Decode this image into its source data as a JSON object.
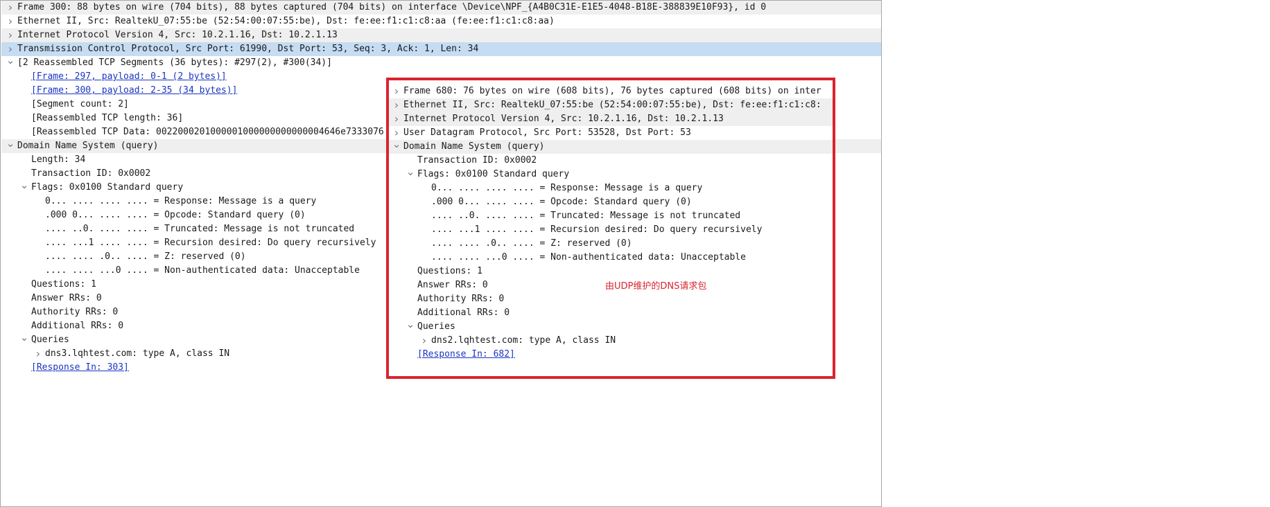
{
  "main_tree": [
    {
      "text": "Frame 300: 88 bytes on wire (704 bits), 88 bytes captured (704 bits) on interface \\Device\\NPF_{A4B0C31E-E1E5-4048-B18E-388839E10F93}, id 0",
      "indent": 0,
      "arrow": "right",
      "style": "shade"
    },
    {
      "text": "Ethernet II, Src: RealtekU_07:55:be (52:54:00:07:55:be), Dst: fe:ee:f1:c1:c8:aa (fe:ee:f1:c1:c8:aa)",
      "indent": 0,
      "arrow": "right",
      "style": "plain"
    },
    {
      "text": "Internet Protocol Version 4, Src: 10.2.1.16, Dst: 10.2.1.13",
      "indent": 0,
      "arrow": "right",
      "style": "shade"
    },
    {
      "text": "Transmission Control Protocol, Src Port: 61990, Dst Port: 53, Seq: 3, Ack: 1, Len: 34",
      "indent": 0,
      "arrow": "right",
      "style": "sel"
    },
    {
      "text": "[2 Reassembled TCP Segments (36 bytes): #297(2), #300(34)]",
      "indent": 0,
      "arrow": "down",
      "style": "plain"
    },
    {
      "text": "[Frame: 297, payload: 0-1 (2 bytes)]",
      "indent": 1,
      "arrow": "",
      "style": "plain",
      "link": true
    },
    {
      "text": "[Frame: 300, payload: 2-35 (34 bytes)]",
      "indent": 1,
      "arrow": "",
      "style": "plain",
      "link": true
    },
    {
      "text": "[Segment count: 2]",
      "indent": 1,
      "arrow": "",
      "style": "plain"
    },
    {
      "text": "[Reassembled TCP length: 36]",
      "indent": 1,
      "arrow": "",
      "style": "plain"
    },
    {
      "text": "[Reassembled TCP Data: 0022000201000001000000000000004646e7333076",
      "indent": 1,
      "arrow": "",
      "style": "plain"
    },
    {
      "text": "Domain Name System (query)",
      "indent": 0,
      "arrow": "down",
      "style": "shade"
    },
    {
      "text": "Length: 34",
      "indent": 1,
      "arrow": "",
      "style": "plain"
    },
    {
      "text": "Transaction ID: 0x0002",
      "indent": 1,
      "arrow": "",
      "style": "plain"
    },
    {
      "text": "Flags: 0x0100 Standard query",
      "indent": 1,
      "arrow": "down",
      "style": "plain"
    },
    {
      "text": "0... .... .... .... = Response: Message is a query",
      "indent": 2,
      "arrow": "",
      "style": "plain"
    },
    {
      "text": ".000 0... .... .... = Opcode: Standard query (0)",
      "indent": 2,
      "arrow": "",
      "style": "plain"
    },
    {
      "text": ".... ..0. .... .... = Truncated: Message is not truncated",
      "indent": 2,
      "arrow": "",
      "style": "plain"
    },
    {
      "text": ".... ...1 .... .... = Recursion desired: Do query recursively",
      "indent": 2,
      "arrow": "",
      "style": "plain"
    },
    {
      "text": ".... .... .0.. .... = Z: reserved (0)",
      "indent": 2,
      "arrow": "",
      "style": "plain"
    },
    {
      "text": ".... .... ...0 .... = Non-authenticated data: Unacceptable",
      "indent": 2,
      "arrow": "",
      "style": "plain"
    },
    {
      "text": "Questions: 1",
      "indent": 1,
      "arrow": "",
      "style": "plain"
    },
    {
      "text": "Answer RRs: 0",
      "indent": 1,
      "arrow": "",
      "style": "plain"
    },
    {
      "text": "Authority RRs: 0",
      "indent": 1,
      "arrow": "",
      "style": "plain"
    },
    {
      "text": "Additional RRs: 0",
      "indent": 1,
      "arrow": "",
      "style": "plain"
    },
    {
      "text": "Queries",
      "indent": 1,
      "arrow": "down",
      "style": "plain"
    },
    {
      "text": "dns3.lqhtest.com: type A, class IN",
      "indent": 2,
      "arrow": "right",
      "style": "plain"
    },
    {
      "text": "[Response In: 303]",
      "indent": 1,
      "arrow": "",
      "style": "plain",
      "link": true
    }
  ],
  "popup_tree": [
    {
      "text": "Frame 680: 76 bytes on wire (608 bits), 76 bytes captured (608 bits) on inter",
      "indent": 0,
      "arrow": "right",
      "style": "plain"
    },
    {
      "text": "Ethernet II, Src: RealtekU_07:55:be (52:54:00:07:55:be), Dst: fe:ee:f1:c1:c8:",
      "indent": 0,
      "arrow": "right",
      "style": "shade"
    },
    {
      "text": "Internet Protocol Version 4, Src: 10.2.1.16, Dst: 10.2.1.13",
      "indent": 0,
      "arrow": "right",
      "style": "shade"
    },
    {
      "text": "User Datagram Protocol, Src Port: 53528, Dst Port: 53",
      "indent": 0,
      "arrow": "right",
      "style": "plain"
    },
    {
      "text": "Domain Name System (query)",
      "indent": 0,
      "arrow": "down",
      "style": "shade"
    },
    {
      "text": "Transaction ID: 0x0002",
      "indent": 1,
      "arrow": "",
      "style": "plain"
    },
    {
      "text": "Flags: 0x0100 Standard query",
      "indent": 1,
      "arrow": "down",
      "style": "plain"
    },
    {
      "text": "0... .... .... .... = Response: Message is a query",
      "indent": 2,
      "arrow": "",
      "style": "plain"
    },
    {
      "text": ".000 0... .... .... = Opcode: Standard query (0)",
      "indent": 2,
      "arrow": "",
      "style": "plain"
    },
    {
      "text": ".... ..0. .... .... = Truncated: Message is not truncated",
      "indent": 2,
      "arrow": "",
      "style": "plain"
    },
    {
      "text": ".... ...1 .... .... = Recursion desired: Do query recursively",
      "indent": 2,
      "arrow": "",
      "style": "plain"
    },
    {
      "text": ".... .... .0.. .... = Z: reserved (0)",
      "indent": 2,
      "arrow": "",
      "style": "plain"
    },
    {
      "text": ".... .... ...0 .... = Non-authenticated data: Unacceptable",
      "indent": 2,
      "arrow": "",
      "style": "plain"
    },
    {
      "text": "Questions: 1",
      "indent": 1,
      "arrow": "",
      "style": "plain"
    },
    {
      "text": "Answer RRs: 0",
      "indent": 1,
      "arrow": "",
      "style": "plain"
    },
    {
      "text": "Authority RRs: 0",
      "indent": 1,
      "arrow": "",
      "style": "plain"
    },
    {
      "text": "Additional RRs: 0",
      "indent": 1,
      "arrow": "",
      "style": "plain"
    },
    {
      "text": "Queries",
      "indent": 1,
      "arrow": "down",
      "style": "plain"
    },
    {
      "text": "dns2.lqhtest.com: type A, class IN",
      "indent": 2,
      "arrow": "right",
      "style": "plain"
    },
    {
      "text": "[Response In: 682]",
      "indent": 1,
      "arrow": "",
      "style": "plain",
      "link": true
    }
  ],
  "annotation": {
    "text": "由UDP维护的DNS请求包",
    "color": "#d9232e"
  },
  "colors": {
    "selected_row": "#c5dcf2",
    "shaded_row": "#efefef",
    "link": "#1a35c0",
    "highlight_border": "#d9232e"
  }
}
